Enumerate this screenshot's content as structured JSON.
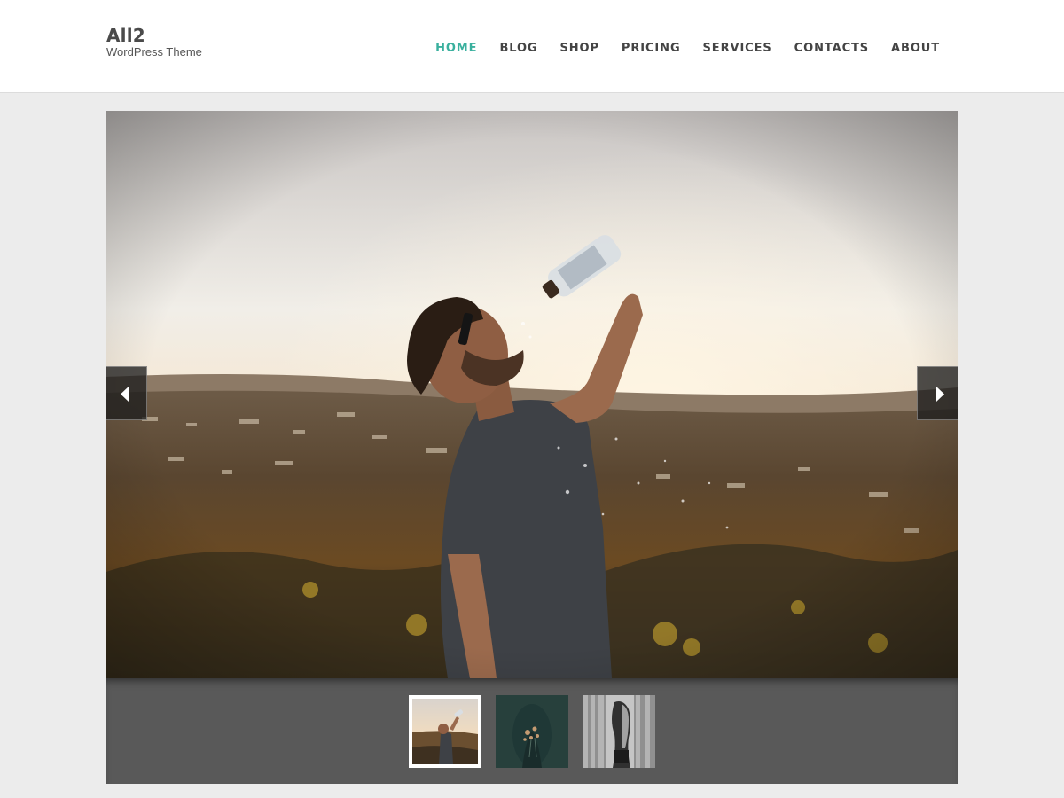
{
  "header": {
    "site_title": "All2",
    "tagline": "WordPress Theme",
    "nav": [
      {
        "label": "HOME",
        "active": true
      },
      {
        "label": "BLOG",
        "active": false
      },
      {
        "label": "SHOP",
        "active": false
      },
      {
        "label": "PRICING",
        "active": false
      },
      {
        "label": "SERVICES",
        "active": false
      },
      {
        "label": "CONTACTS",
        "active": false
      },
      {
        "label": "ABOUT",
        "active": false
      }
    ]
  },
  "slider": {
    "current_slide": 1,
    "slide_count": 3,
    "slides": [
      {
        "image": "man-drinking-water-at-sunset"
      },
      {
        "image": "person-holding-flowers-dark-teal"
      },
      {
        "image": "woman-black-and-white-portrait"
      }
    ],
    "prev_icon": "chevron-left-icon",
    "next_icon": "chevron-right-icon"
  },
  "colors": {
    "accent": "#3ab09e",
    "nav_text": "#444444",
    "page_bg": "#ececec",
    "thumb_strip_bg": "#595959"
  }
}
